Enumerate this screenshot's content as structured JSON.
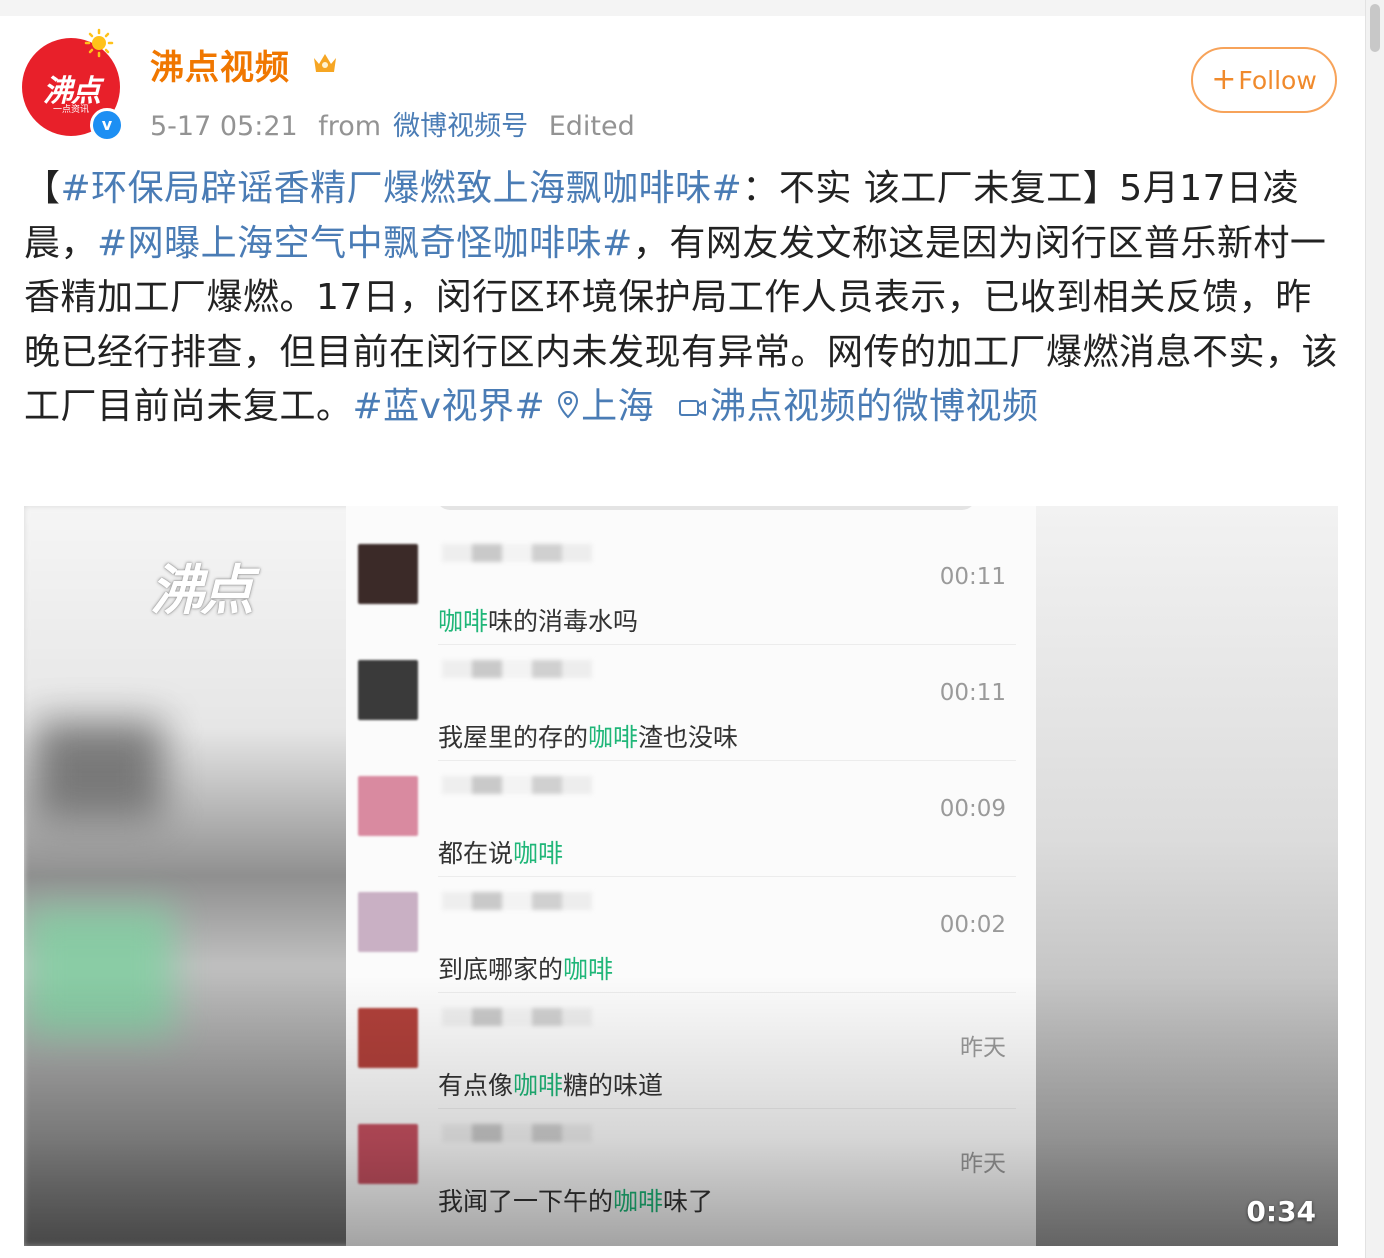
{
  "post": {
    "author": "沸点视频",
    "avatar_text": "沸点",
    "avatar_sub": "一点资讯",
    "verified_badge": "v",
    "time": "5-17 05:21",
    "from_label": "from",
    "source": "微博视频号",
    "edited": "Edited",
    "follow_label": "Follow",
    "text": {
      "p1": "【",
      "tag1": "#环保局辟谣香精厂爆燃致上海飘咖啡味#",
      "p2": "：不实 该工厂未复工】5月17日凌晨，",
      "tag2": "#网曝上海空气中飘奇怪咖啡味#",
      "p3": "，有网友发文称这是因为闵行区普乐新村一香精加工厂爆燃。17日，闵行区环境保护局工作人员表示，已收到相关反馈，昨晚已经行排查，但目前在闵行区内未发现有异常。网传的加工厂爆燃消息不实，该工厂目前尚未复工。",
      "tag3": "#蓝v视界#",
      "location": "上海",
      "video_link": "沸点视频的微博视频"
    }
  },
  "video": {
    "watermark": "沸点",
    "duration": "0:34",
    "chat": [
      {
        "time": "00:11",
        "pre": "",
        "hl": "咖啡",
        "post": "味的消毒水吗",
        "avatar_color": "#3b2a28"
      },
      {
        "time": "00:11",
        "pre": "我屋里的存的",
        "hl": "咖啡",
        "post": "渣也没味",
        "avatar_color": "#3a3a3a"
      },
      {
        "time": "00:09",
        "pre": "都在说",
        "hl": "咖啡",
        "post": "",
        "avatar_color": "#d98aa0"
      },
      {
        "time": "00:02",
        "pre": "到底哪家的",
        "hl": "咖啡",
        "post": "",
        "avatar_color": "#c9b0c4"
      },
      {
        "time": "昨天",
        "pre": "有点像",
        "hl": "咖啡",
        "post": "糖的味道",
        "avatar_color": "#b0403a"
      },
      {
        "time": "昨天",
        "pre": "我闻了一下午的",
        "hl": "咖啡",
        "post": "味了",
        "avatar_color": "#c55060"
      }
    ]
  }
}
